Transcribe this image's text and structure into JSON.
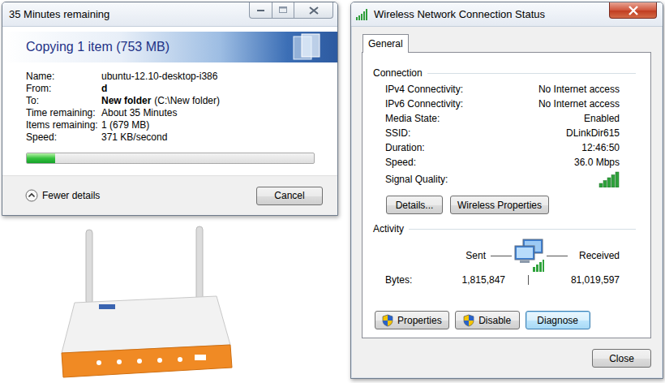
{
  "copy_window": {
    "title": "35 Minutes remaining",
    "header": "Copying 1 item (753 MB)",
    "details": [
      {
        "label": "Name:",
        "value": "ubuntu-12.10-desktop-i386",
        "bold": false,
        "note": ""
      },
      {
        "label": "From:",
        "value": "d",
        "bold": true,
        "note": ""
      },
      {
        "label": "To:",
        "value": "New folder",
        "bold": true,
        "note": "(C:\\New folder)"
      },
      {
        "label": "Time remaining:",
        "value": "About 35 Minutes",
        "bold": false,
        "note": ""
      },
      {
        "label": "Items remaining:",
        "value": "1 (679 MB)",
        "bold": false,
        "note": ""
      },
      {
        "label": "Speed:",
        "value": "371 KB/second",
        "bold": false,
        "note": ""
      }
    ],
    "progress": {
      "level": 0.1
    },
    "details_toggle": {
      "label": "Fewer details",
      "expanded": true
    },
    "buttons": [
      "Cancel"
    ]
  },
  "status_window": {
    "title": "Wireless Network Connection Status",
    "tabs": [
      {
        "label": "General",
        "selected": true
      }
    ],
    "connection": {
      "heading": "Connection",
      "rows": [
        {
          "label": "IPv4 Connectivity:",
          "value": "No Internet access"
        },
        {
          "label": "IPv6 Connectivity:",
          "value": "No Internet access"
        },
        {
          "label": "Media State:",
          "value": "Enabled"
        },
        {
          "label": "SSID:",
          "value": "DLinkDir615"
        },
        {
          "label": "Duration:",
          "value": "12:46:50"
        },
        {
          "label": "Speed:",
          "value": "36.0 Mbps"
        }
      ],
      "signal": {
        "label": "Signal Quality:",
        "level": 1.0
      },
      "buttons": [
        "Details...",
        "Wireless Properties"
      ]
    },
    "activity": {
      "heading": "Activity",
      "sent_label": "Sent",
      "received_label": "Received",
      "bytes_label": "Bytes:",
      "sent": "1,815,847",
      "received": "81,019,597"
    },
    "buttons": [
      {
        "label": "Properties",
        "shield": true,
        "focused": false
      },
      {
        "label": "Disable",
        "shield": true,
        "focused": false
      },
      {
        "label": "Diagnose",
        "shield": false,
        "focused": true
      }
    ],
    "close_button": "Close"
  }
}
